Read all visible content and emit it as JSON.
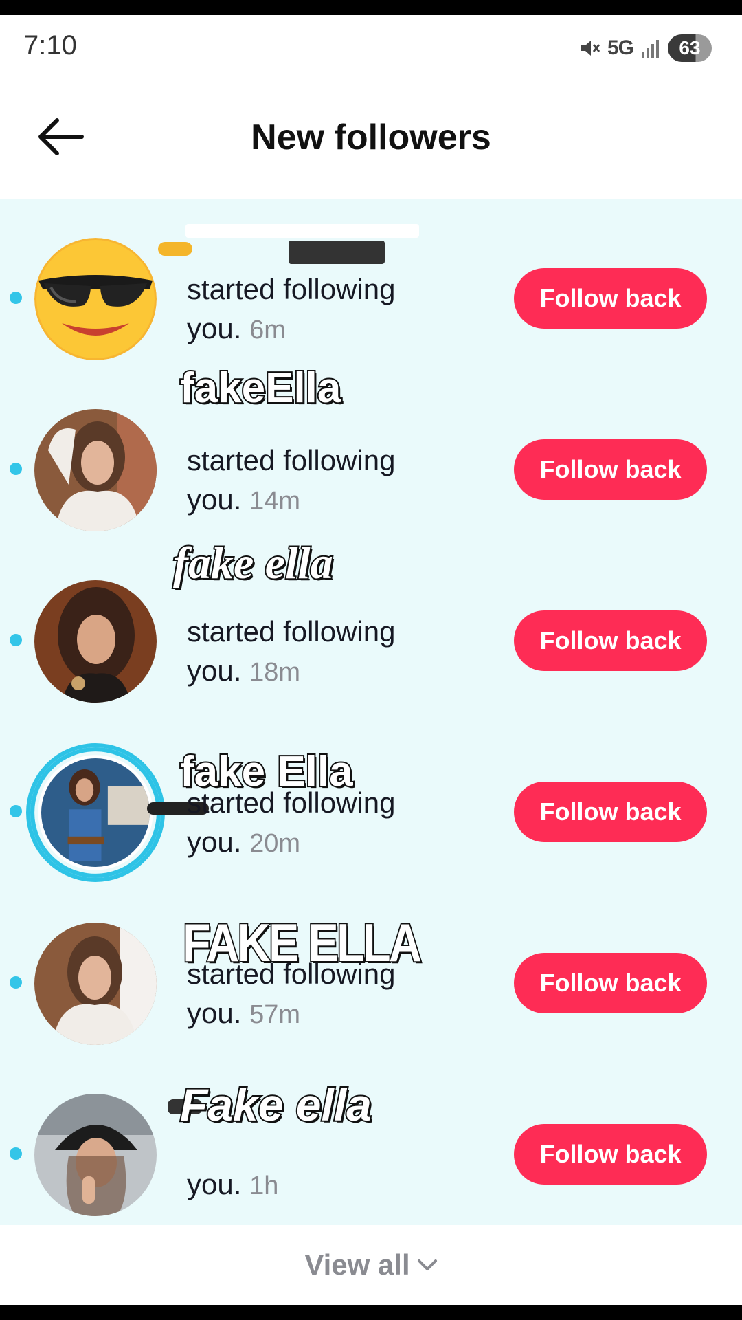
{
  "status_bar": {
    "time": "7:10",
    "network": "5G",
    "battery": "63"
  },
  "header": {
    "title": "New followers"
  },
  "followers": [
    {
      "name_overlay": "",
      "action": "started following",
      "you": "you.",
      "time": "6m",
      "button": "Follow back"
    },
    {
      "name_overlay": "fakeElla",
      "action": "started following",
      "you": "you.",
      "time": "14m",
      "button": "Follow back"
    },
    {
      "name_overlay": "fake ella",
      "action": "started following",
      "you": "you.",
      "time": "18m",
      "button": "Follow back"
    },
    {
      "name_overlay": "fake Ella",
      "action": "started following",
      "you": "you.",
      "time": "20m",
      "button": "Follow back"
    },
    {
      "name_overlay": "FAKE ELLA",
      "action": "started following",
      "you": "you.",
      "time": "57m",
      "button": "Follow back"
    },
    {
      "name_overlay": "Fake ella",
      "action": "",
      "you": "you.",
      "time": "1h",
      "button": "Follow back"
    }
  ],
  "footer": {
    "view_all": "View all"
  },
  "colors": {
    "follow_button": "#fe2c55",
    "list_background": "#eafafb",
    "unread_dot": "#33c5e8"
  }
}
